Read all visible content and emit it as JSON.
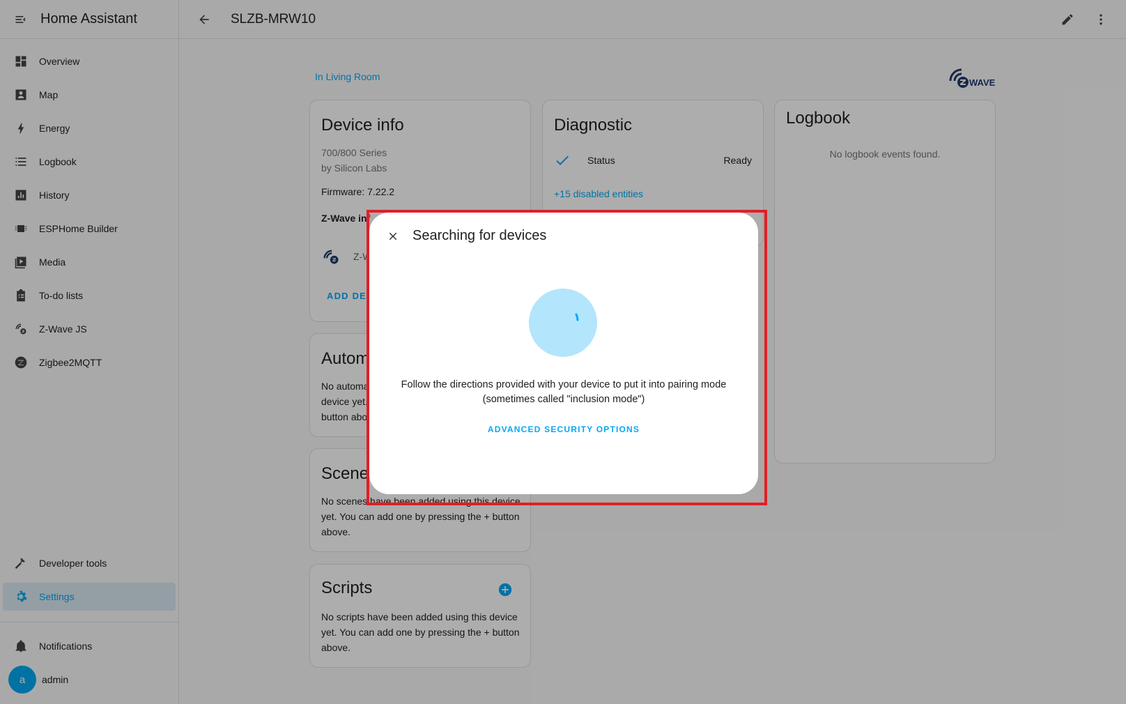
{
  "app": {
    "title": "Home Assistant"
  },
  "sidebar": {
    "items": [
      {
        "label": "Overview",
        "icon": "dashboard-icon"
      },
      {
        "label": "Map",
        "icon": "map-person-icon"
      },
      {
        "label": "Energy",
        "icon": "lightning-icon"
      },
      {
        "label": "Logbook",
        "icon": "list-icon"
      },
      {
        "label": "History",
        "icon": "chart-box-icon"
      },
      {
        "label": "ESPHome Builder",
        "icon": "chip-icon"
      },
      {
        "label": "Media",
        "icon": "play-box-icon"
      },
      {
        "label": "To-do lists",
        "icon": "clipboard-list-icon"
      },
      {
        "label": "Z-Wave JS",
        "icon": "zwave-icon"
      },
      {
        "label": "Zigbee2MQTT",
        "icon": "zigbee-icon"
      }
    ],
    "developer_tools": "Developer tools",
    "settings": "Settings",
    "notifications": "Notifications",
    "user": {
      "initial": "a",
      "name": "admin"
    }
  },
  "topbar": {
    "title": "SLZB-MRW10"
  },
  "area_link": "In Living Room",
  "device_info": {
    "title": "Device info",
    "model": "700/800 Series",
    "manufacturer": "by Silicon Labs",
    "firmware": "Firmware: 7.22.2",
    "zwave_info_label": "Z-Wave inf",
    "zwave_row_label": "Z-W",
    "add_button": "ADD DEV"
  },
  "diagnostic": {
    "title": "Diagnostic",
    "status_label": "Status",
    "status_value": "Ready",
    "disabled_link": "+15 disabled entities"
  },
  "logbook": {
    "title": "Logbook",
    "empty": "No logbook events found."
  },
  "automations": {
    "title": "Autom",
    "lines": [
      "No automa",
      "device yet.",
      "button abo"
    ]
  },
  "scenes": {
    "title": "Scene",
    "lines": [
      "No scenes have been added using this device",
      "yet. You can add one by pressing the + button",
      "above."
    ]
  },
  "scripts": {
    "title": "Scripts",
    "lines": [
      "No scripts have been added using this device",
      "yet. You can add one by pressing the + button",
      "above."
    ]
  },
  "dialog": {
    "title": "Searching for devices",
    "instruction_line1": "Follow the directions provided with your device to put it into pairing mode",
    "instruction_line2": "(sometimes called \"inclusion mode\")",
    "advanced_button": "ADVANCED SECURITY OPTIONS"
  },
  "colors": {
    "accent": "#03a9f4",
    "highlight": "#e01f26",
    "spinner_bg": "#b3e5fc"
  }
}
